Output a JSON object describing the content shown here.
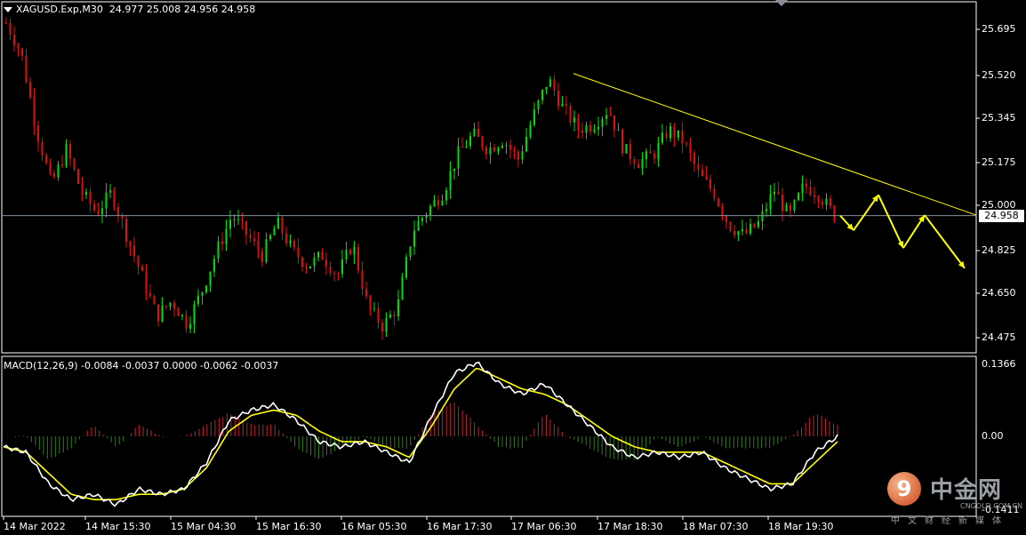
{
  "header": {
    "symbol": "XAGUSD.Exp,M30",
    "ohlc": "24.977 25.008 24.956 24.958",
    "macd": "MACD(12,26,9) -0.0084 -0.0037 0.0000 -0.0062 -0.0037"
  },
  "current_price": "24.958",
  "colors": {
    "background": "#000000",
    "bull": "#00e000",
    "bear": "#e01010",
    "trendline": "#ffff00",
    "macd_main": "#ffffff",
    "macd_signal": "#ffff00"
  },
  "logo": {
    "text": "中金网",
    "url": "CNGOLD.COM.CN",
    "sub": "中文财经新媒体"
  },
  "chart_data": [
    {
      "type": "candlestick",
      "title": "XAGUSD.Exp,M30",
      "ylim": [
        24.42,
        25.78
      ],
      "y_ticks": [
        "25.695",
        "25.520",
        "25.345",
        "25.175",
        "25.000",
        "24.825",
        "24.650",
        "24.475"
      ],
      "x_ticks": [
        "14 Mar 2022",
        "14 Mar 15:30",
        "15 Mar 04:30",
        "15 Mar 16:30",
        "16 Mar 05:30",
        "16 Mar 17:30",
        "17 Mar 06:30",
        "17 Mar 18:30",
        "18 Mar 07:30",
        "18 Mar 19:30"
      ],
      "close_path": [
        25.72,
        25.6,
        25.3,
        25.08,
        25.22,
        25.05,
        24.97,
        25.05,
        24.88,
        24.72,
        24.56,
        24.62,
        24.53,
        24.66,
        24.82,
        24.96,
        24.88,
        24.8,
        24.93,
        24.82,
        24.76,
        24.8,
        24.72,
        24.85,
        24.6,
        24.52,
        24.6,
        24.9,
        24.98,
        25.05,
        25.2,
        25.28,
        25.22,
        25.26,
        25.18,
        25.35,
        25.5,
        25.38,
        25.3,
        25.32,
        25.38,
        25.22,
        25.17,
        25.2,
        25.3,
        25.25,
        25.12,
        25.05,
        24.92,
        24.88,
        24.93,
        25.06,
        24.95,
        25.08,
        25.04,
        24.958
      ],
      "current_price": 24.958,
      "trendline": {
        "from": [
          "17 Mar 06:30",
          25.52
        ],
        "to_price_at_edge": 24.96
      },
      "forecast_arrows": [
        [
          24.958,
          24.9
        ],
        [
          24.9,
          25.04
        ],
        [
          25.04,
          24.83
        ],
        [
          24.83,
          24.96
        ],
        [
          24.96,
          24.75
        ]
      ]
    },
    {
      "type": "line",
      "title": "MACD(12,26,9)",
      "y_ticks": [
        "0.1366",
        "0.00",
        "-0.1411"
      ],
      "ylim": [
        -0.1411,
        0.1366
      ],
      "values": {
        "main": -0.0084,
        "signal": -0.0037
      },
      "series": [
        {
          "name": "MACD",
          "values": [
            -0.02,
            -0.03,
            -0.09,
            -0.12,
            -0.11,
            -0.13,
            -0.1,
            -0.11,
            -0.1,
            -0.05,
            0.03,
            0.05,
            0.06,
            0.03,
            -0.01,
            -0.02,
            -0.01,
            -0.03,
            -0.05,
            0.04,
            0.12,
            0.14,
            0.1,
            0.08,
            0.1,
            0.06,
            0.02,
            -0.02,
            -0.04,
            -0.03,
            -0.04,
            -0.03,
            -0.06,
            -0.08,
            -0.1,
            -0.09,
            -0.03,
            0.0
          ]
        },
        {
          "name": "Signal",
          "values": [
            -0.02,
            -0.03,
            -0.07,
            -0.11,
            -0.12,
            -0.12,
            -0.11,
            -0.11,
            -0.1,
            -0.06,
            0.01,
            0.04,
            0.05,
            0.04,
            0.01,
            -0.01,
            -0.01,
            -0.02,
            -0.04,
            0.02,
            0.09,
            0.13,
            0.11,
            0.09,
            0.08,
            0.06,
            0.03,
            0.0,
            -0.02,
            -0.03,
            -0.03,
            -0.03,
            -0.05,
            -0.07,
            -0.09,
            -0.09,
            -0.05,
            -0.01
          ]
        }
      ]
    }
  ]
}
